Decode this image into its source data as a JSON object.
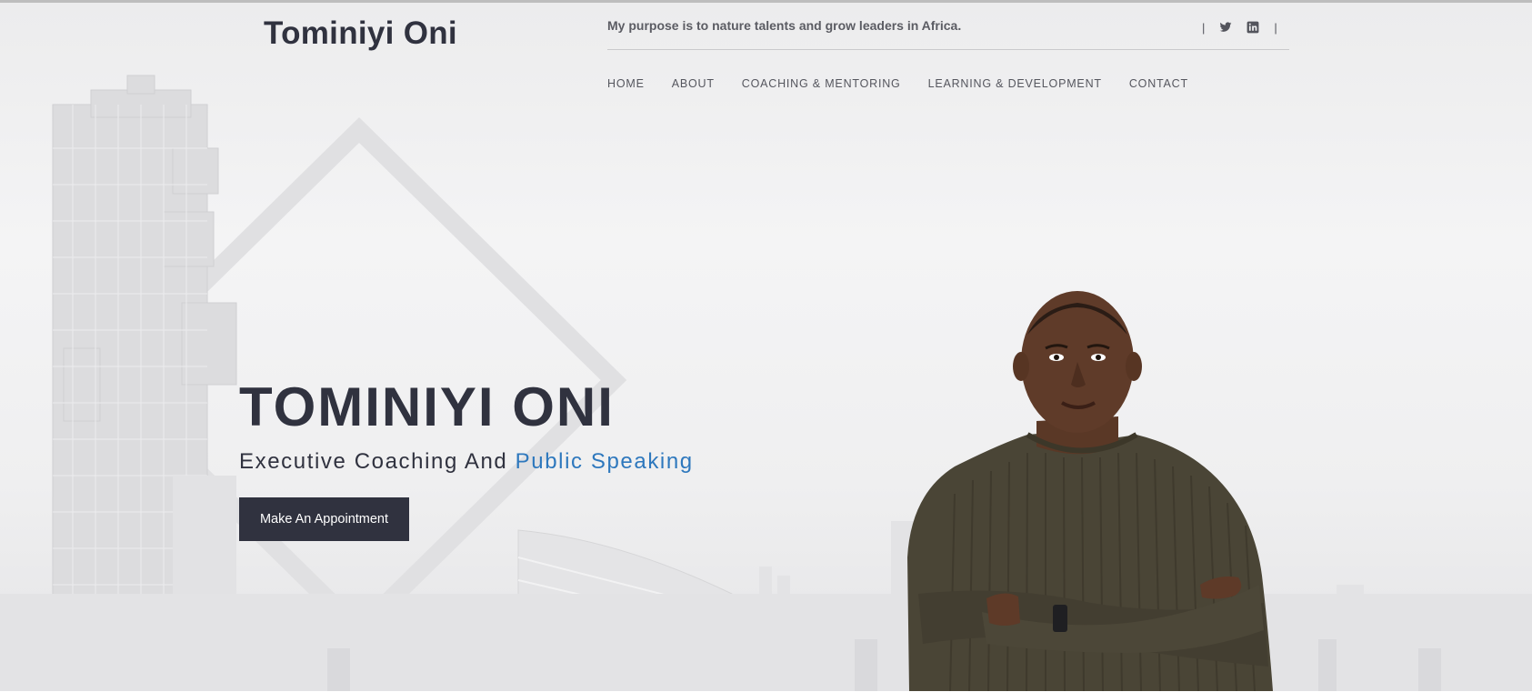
{
  "header": {
    "site_title": "Tominiyi Oni",
    "tagline": "My purpose is to nature talents and grow leaders in Africa.",
    "social": {
      "separator": "|",
      "icons": [
        "twitter-icon",
        "linkedin-icon"
      ]
    }
  },
  "nav": {
    "items": [
      {
        "label": "HOME"
      },
      {
        "label": "ABOUT"
      },
      {
        "label": "COACHING & MENTORING"
      },
      {
        "label": "LEARNING & DEVELOPMENT"
      },
      {
        "label": "CONTACT"
      }
    ]
  },
  "hero": {
    "title": "TOMINIYI ONI",
    "subtitle_plain": "Executive Coaching And ",
    "subtitle_accent": "Public Speaking",
    "cta_label": "Make An Appointment"
  },
  "colors": {
    "text_dark": "#30323f",
    "accent_blue": "#2e78bd",
    "button_bg": "#30323f",
    "background": "#efeff0"
  }
}
